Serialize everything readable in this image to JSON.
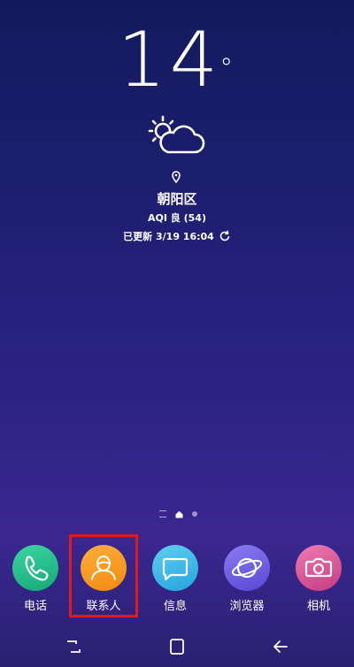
{
  "weather": {
    "temperature": "14",
    "degree_symbol": "°",
    "condition_icon": "partly-cloudy-icon",
    "location": "朝阳区",
    "aqi": "AQI 良 (54)",
    "updated": "已更新 3/19 16:04"
  },
  "pager": {
    "current_page": "home"
  },
  "dock": {
    "apps": [
      {
        "label": "电话",
        "icon": "phone-icon",
        "color": "#22c28a"
      },
      {
        "label": "联系人",
        "icon": "contacts-icon",
        "color": "#f7941d"
      },
      {
        "label": "信息",
        "icon": "messages-icon",
        "color": "#3fb7e8"
      },
      {
        "label": "浏览器",
        "icon": "browser-icon",
        "color": "#6b5ce0"
      },
      {
        "label": "相机",
        "icon": "camera-icon",
        "color": "#d44d8a"
      }
    ],
    "highlighted_app": "联系人",
    "highlight_color": "#e0191e"
  },
  "nav": {
    "buttons": [
      "recents-button",
      "home-button",
      "back-button"
    ]
  }
}
